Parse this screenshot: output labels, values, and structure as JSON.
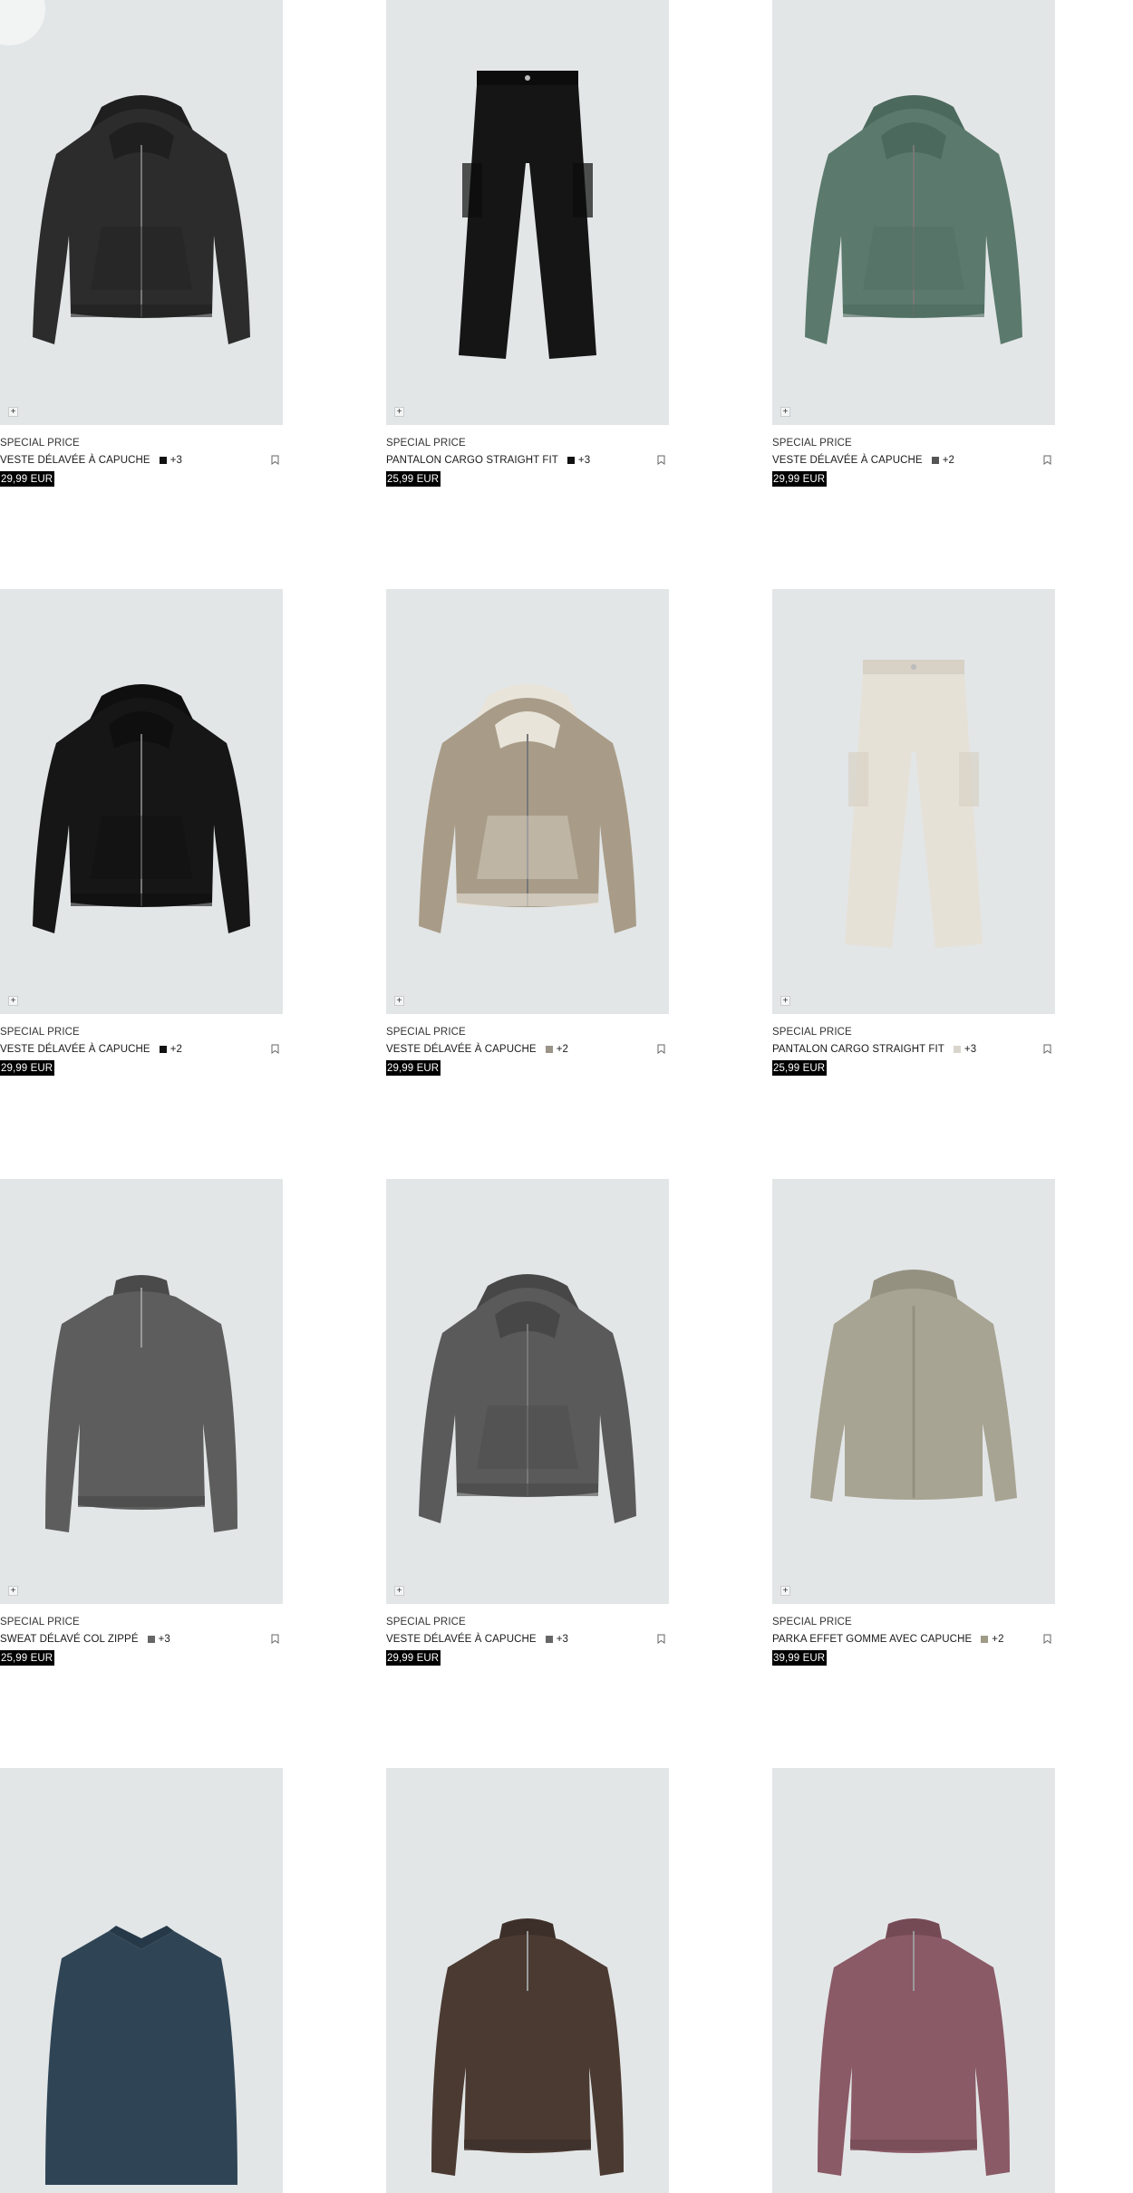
{
  "products": [
    {
      "tag": "SPECIAL PRICE",
      "name": "VESTE DÉLAVÉE À CAPUCHE",
      "swatch": "#111111",
      "more": "+3",
      "price": "29,99 EUR",
      "garment": "hoodie",
      "color": "#2c2c2c",
      "color2": "#1f1f1f"
    },
    {
      "tag": "SPECIAL PRICE",
      "name": "PANTALON CARGO STRAIGHT FIT",
      "swatch": "#111111",
      "more": "+3",
      "price": "25,99 EUR",
      "garment": "pants",
      "color": "#151515",
      "color2": "#0c0c0c"
    },
    {
      "tag": "SPECIAL PRICE",
      "name": "VESTE DÉLAVÉE À CAPUCHE",
      "swatch": "#555555",
      "more": "+2",
      "price": "29,99 EUR",
      "garment": "hoodie",
      "color": "#5b7a6d",
      "color2": "#4c695d"
    },
    {
      "tag": "SPECIAL PRICE",
      "name": "VESTE DÉLAVÉE À CAPUCHE",
      "swatch": "#111111",
      "more": "+2",
      "price": "29,99 EUR",
      "garment": "hoodie",
      "color": "#161616",
      "color2": "#0f0f0f"
    },
    {
      "tag": "SPECIAL PRICE",
      "name": "VESTE DÉLAVÉE À CAPUCHE",
      "swatch": "#9a9388",
      "more": "+2",
      "price": "29,99 EUR",
      "garment": "hoodie",
      "color": "#a89c88",
      "color2": "#e9e4da"
    },
    {
      "tag": "SPECIAL PRICE",
      "name": "PANTALON CARGO STRAIGHT FIT",
      "swatch": "#d9d5cc",
      "more": "+3",
      "price": "25,99 EUR",
      "garment": "pants",
      "color": "#e6e1d7",
      "color2": "#d7d1c6"
    },
    {
      "tag": "SPECIAL PRICE",
      "name": "SWEAT DÉLAVÉ COL ZIPPÉ",
      "swatch": "#666666",
      "more": "+3",
      "price": "25,99 EUR",
      "garment": "sweat",
      "color": "#5d5d5d",
      "color2": "#4a4a4a"
    },
    {
      "tag": "SPECIAL PRICE",
      "name": "VESTE DÉLAVÉE À CAPUCHE",
      "swatch": "#666666",
      "more": "+3",
      "price": "29,99 EUR",
      "garment": "hoodie",
      "color": "#5a5a5a",
      "color2": "#474747"
    },
    {
      "tag": "SPECIAL PRICE",
      "name": "PARKA EFFET GOMME AVEC CAPUCHE",
      "swatch": "#9e9b86",
      "more": "+2",
      "price": "39,99 EUR",
      "garment": "parka",
      "color": "#a8a493",
      "color2": "#959181"
    },
    {
      "garment": "polo",
      "color": "#2f4556",
      "color2": "#263949"
    },
    {
      "garment": "sweat",
      "color": "#4a3a32",
      "color2": "#3c2f29"
    },
    {
      "garment": "sweat",
      "color": "#8a5a66",
      "color2": "#744a55"
    }
  ]
}
